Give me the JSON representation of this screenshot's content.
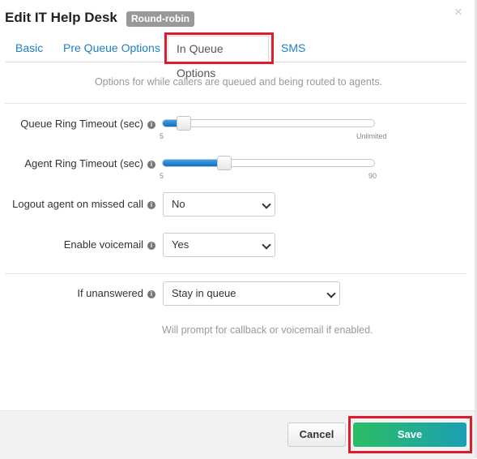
{
  "dialog": {
    "title": "Edit IT Help Desk",
    "badge": "Round-robin",
    "close_icon": "×"
  },
  "tabs": [
    {
      "label": "Basic",
      "active": false
    },
    {
      "label": "Pre Queue Options",
      "active": false
    },
    {
      "label": "In Queue Options",
      "active": true
    },
    {
      "label": "SMS",
      "active": false
    }
  ],
  "description": "Options for while callers are queued and being routed to agents.",
  "fields": {
    "queue_ring_timeout": {
      "label": "Queue Ring Timeout (sec)",
      "min_label": "5",
      "max_label": "Unlimited",
      "fill_fraction": 0.1
    },
    "agent_ring_timeout": {
      "label": "Agent Ring Timeout (sec)",
      "min_label": "5",
      "max_label": "90",
      "fill_fraction": 0.29
    },
    "logout_agent": {
      "label": "Logout agent on missed call",
      "value": "No"
    },
    "enable_voicemail": {
      "label": "Enable voicemail",
      "value": "Yes"
    },
    "if_unanswered": {
      "label": "If unanswered",
      "value": "Stay in queue",
      "hint": "Will prompt for callback or voicemail if enabled."
    }
  },
  "icons": {
    "info": "i"
  },
  "footer": {
    "cancel_label": "Cancel",
    "save_label": "Save"
  },
  "colors": {
    "accent_link": "#1e7fc2",
    "highlight_box": "#e01b2c",
    "save_gradient_start": "#2bbd63",
    "save_gradient_end": "#1aa0b5",
    "slider_fill": "#1a7fd0"
  }
}
